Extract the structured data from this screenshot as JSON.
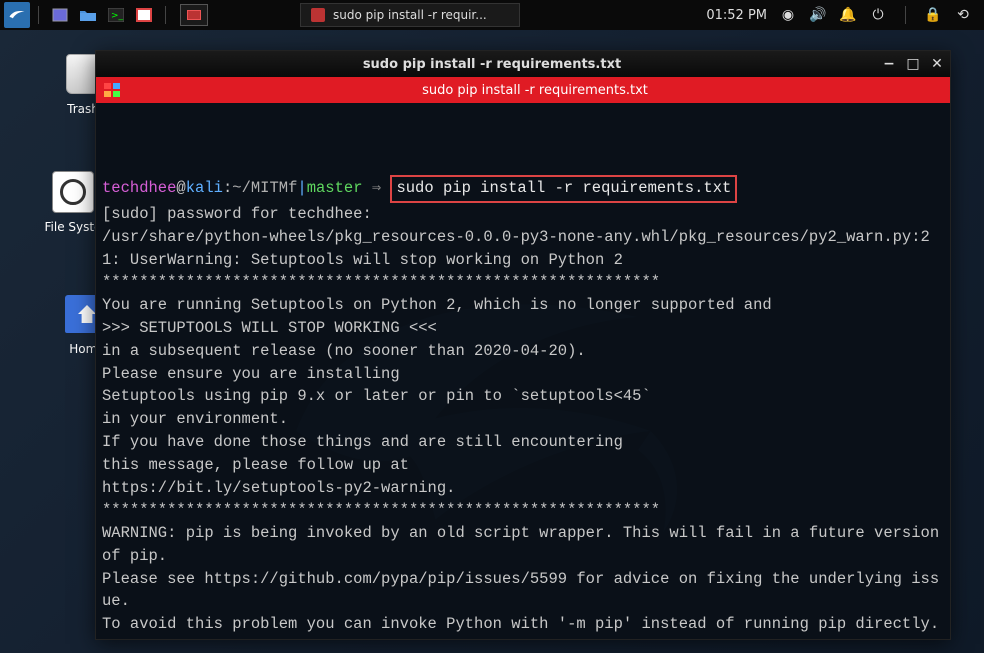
{
  "panel": {
    "clock": "01:52 PM",
    "taskbar_label": "sudo pip install -r requir..."
  },
  "desktop": {
    "trash_label": "Trash",
    "filesystem_label": "File Syste",
    "home_label": "Home"
  },
  "terminal": {
    "window_title": "sudo pip install -r requirements.txt",
    "tab_title": "sudo pip install -r requirements.txt",
    "prompt": {
      "user": "techdhee",
      "at": "@",
      "host": "kali",
      "colon": ":",
      "path": "~/MITMf",
      "sep": "|",
      "branch": "master",
      "arrow": " ⇒ "
    },
    "command": "sudo pip install -r requirements.txt",
    "output": "[sudo] password for techdhee:\n/usr/share/python-wheels/pkg_resources-0.0.0-py3-none-any.whl/pkg_resources/py2_warn.py:21: UserWarning: Setuptools will stop working on Python 2\n************************************************************\nYou are running Setuptools on Python 2, which is no longer supported and\n>>> SETUPTOOLS WILL STOP WORKING <<<\nin a subsequent release (no sooner than 2020-04-20).\nPlease ensure you are installing\nSetuptools using pip 9.x or later or pin to `setuptools<45`\nin your environment.\nIf you have done those things and are still encountering\nthis message, please follow up at\nhttps://bit.ly/setuptools-py2-warning.\n************************************************************\nWARNING: pip is being invoked by an old script wrapper. This will fail in a future version of pip.\nPlease see https://github.com/pypa/pip/issues/5599 for advice on fixing the underlying issue.\nTo avoid this problem you can invoke Python with '-m pip' instead of running pip directly."
  }
}
